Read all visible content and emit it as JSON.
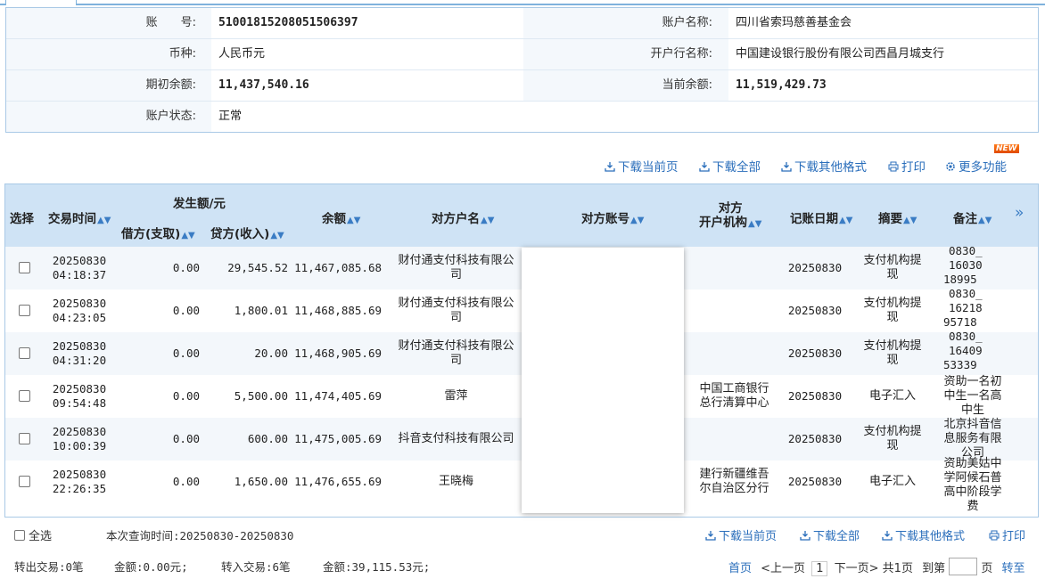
{
  "info": {
    "account_no_label": "账　　号:",
    "account_no": "51001815208051506397",
    "account_name_label": "账户名称:",
    "account_name": "四川省索玛慈善基金会",
    "currency_label": "币种:",
    "currency": "人民币元",
    "bank_label": "开户行名称:",
    "bank": "中国建设银行股份有限公司西昌月城支行",
    "opening_balance_label": "期初余额:",
    "opening_balance": "11,437,540.16",
    "current_balance_label": "当前余额:",
    "current_balance": "11,519,429.73",
    "status_label": "账户状态:",
    "status": "正常"
  },
  "toolbar": {
    "download_page": "下载当前页",
    "download_all": "下载全部",
    "download_other": "下载其他格式",
    "print": "打印",
    "more": "更多功能",
    "new_badge": "NEW"
  },
  "table": {
    "headers": {
      "select": "选择",
      "time": "交易时间",
      "amount_group": "发生额/元",
      "debit": "借方(支取)",
      "credit": "贷方(收入)",
      "balance": "余额",
      "counter_name": "对方户名",
      "counter_account": "对方账号",
      "counter_bank_1": "对方",
      "counter_bank_2": "开户机构",
      "post_date": "记账日期",
      "summary": "摘要",
      "note": "备注",
      "expand": "»"
    },
    "rows": [
      {
        "date": "20250830",
        "time": "04:18:37",
        "debit": "0.00",
        "credit": "29,545.52",
        "balance": "11,467,085.68",
        "name_1": "财付通支付科技有限公",
        "name_2": "司",
        "bank_1": "",
        "bank_2": "",
        "post_date": "20250830",
        "summary_1": "支付机构提",
        "summary_2": "现",
        "note_1": "0830_",
        "note_2": "16030",
        "note_3": "18995"
      },
      {
        "date": "20250830",
        "time": "04:23:05",
        "debit": "0.00",
        "credit": "1,800.01",
        "balance": "11,468,885.69",
        "name_1": "财付通支付科技有限公",
        "name_2": "司",
        "bank_1": "",
        "bank_2": "",
        "post_date": "20250830",
        "summary_1": "支付机构提",
        "summary_2": "现",
        "note_1": "0830_",
        "note_2": "16218",
        "note_3": "95718"
      },
      {
        "date": "20250830",
        "time": "04:31:20",
        "debit": "0.00",
        "credit": "20.00",
        "balance": "11,468,905.69",
        "name_1": "财付通支付科技有限公",
        "name_2": "司",
        "bank_1": "",
        "bank_2": "",
        "post_date": "20250830",
        "summary_1": "支付机构提",
        "summary_2": "现",
        "note_1": "0830_",
        "note_2": "16409",
        "note_3": "53339"
      },
      {
        "date": "20250830",
        "time": "09:54:48",
        "debit": "0.00",
        "credit": "5,500.00",
        "balance": "11,474,405.69",
        "name_1": "雷萍",
        "name_2": "",
        "bank_1": "中国工商银行",
        "bank_2": "总行清算中心",
        "post_date": "20250830",
        "summary_1": "电子汇入",
        "summary_2": "",
        "note_1": "资助一名初",
        "note_2": "中生一名高",
        "note_3": "中生"
      },
      {
        "date": "20250830",
        "time": "10:00:39",
        "debit": "0.00",
        "credit": "600.00",
        "balance": "11,475,005.69",
        "name_1": "抖音支付科技有限公司",
        "name_2": "",
        "bank_1": "",
        "bank_2": "",
        "post_date": "20250830",
        "summary_1": "支付机构提",
        "summary_2": "现",
        "note_1": "北京抖音信",
        "note_2": "息服务有限",
        "note_3": "公司"
      },
      {
        "date": "20250830",
        "time": "22:26:35",
        "debit": "0.00",
        "credit": "1,650.00",
        "balance": "11,476,655.69",
        "name_1": "王晓梅",
        "name_2": "",
        "bank_1": "建行新疆维吾",
        "bank_2": "尔自治区分行",
        "post_date": "20250830",
        "summary_1": "电子汇入",
        "summary_2": "",
        "note_1": "资助美姑中",
        "note_2": "学阿候石普",
        "note_3": "高中阶段学",
        "note_4": "费"
      }
    ]
  },
  "footer": {
    "select_all": "全选",
    "query_time": "本次查询时间:20250830-20250830",
    "download_page": "下载当前页",
    "download_all": "下载全部",
    "download_other": "下载其他格式",
    "print": "打印",
    "out_tx": "转出交易:0笔",
    "out_amount": "金额:0.00元;",
    "in_tx": "转入交易:6笔",
    "in_amount": "金额:39,115.53元;",
    "first": "首页",
    "prev": "<上一页",
    "page_no": "1",
    "next": "下一页>",
    "total": "共1页",
    "goto_prefix": "到第",
    "goto_suffix": "页",
    "goto_btn": "转至"
  }
}
